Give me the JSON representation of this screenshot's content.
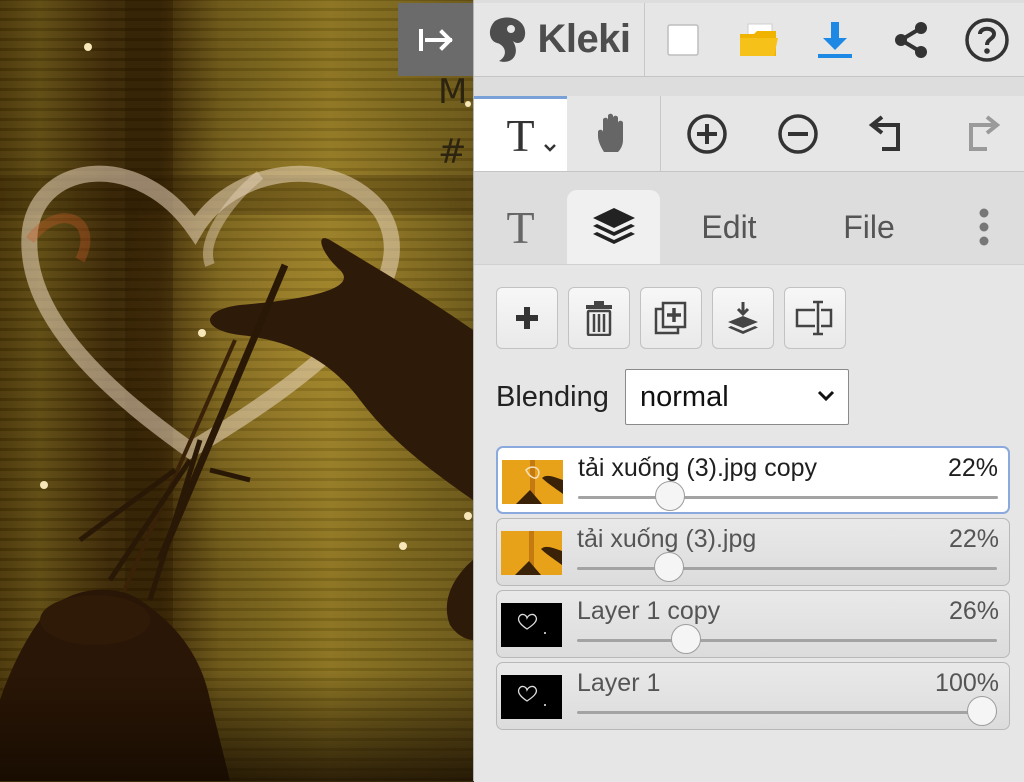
{
  "app": {
    "name": "Kleki"
  },
  "canvas": {
    "text_line1": "M",
    "text_line2": "#"
  },
  "toolbar_top": {
    "icons": [
      "collapse-panel-icon",
      "kleki-logo-icon",
      "new-image-icon",
      "open-folder-icon",
      "download-icon",
      "share-icon",
      "help-icon"
    ]
  },
  "toolbar_tools": {
    "text_tool_glyph": "T",
    "icons": [
      "text-tool-icon",
      "hand-tool-icon",
      "zoom-in-icon",
      "zoom-out-icon",
      "undo-icon",
      "redo-icon"
    ]
  },
  "tabs": [
    {
      "id": "brush",
      "label": "T"
    },
    {
      "id": "layers",
      "icon": "layers-icon",
      "active": true
    },
    {
      "id": "edit",
      "label": "Edit"
    },
    {
      "id": "file",
      "label": "File"
    },
    {
      "id": "more",
      "icon": "vertical-dots-icon"
    }
  ],
  "layer_actions": [
    "add-layer-icon",
    "delete-layer-icon",
    "duplicate-layer-icon",
    "merge-down-icon",
    "rename-layer-icon"
  ],
  "blending": {
    "label": "Blending",
    "value": "normal"
  },
  "layers": [
    {
      "name": "tải xuống (3).jpg copy",
      "opacity_label": "22%",
      "opacity": 0.22,
      "active": true,
      "thumb": "photo"
    },
    {
      "name": "tải xuống (3).jpg",
      "opacity_label": "22%",
      "opacity": 0.22,
      "active": false,
      "thumb": "photo"
    },
    {
      "name": "Layer 1 copy",
      "opacity_label": "26%",
      "opacity": 0.26,
      "active": false,
      "thumb": "heart"
    },
    {
      "name": "Layer 1",
      "opacity_label": "100%",
      "opacity": 1.0,
      "active": false,
      "thumb": "heart"
    }
  ],
  "colors": {
    "accent": "#1e88e5",
    "folder": "#f0b400",
    "active_border": "#8aa9dc"
  }
}
